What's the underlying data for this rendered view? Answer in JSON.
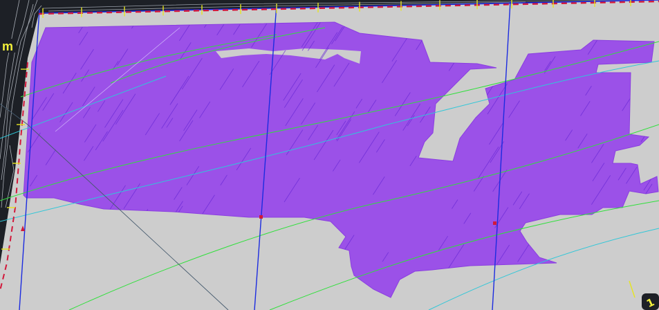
{
  "canvas": {
    "background_dark": "#1d2026",
    "sheet_color": "#cdcdcd",
    "polygon_fill": "#9b51e8",
    "polygon_hatch": "#6a2ad6",
    "grid_blue": "#1b2be0",
    "contour_green": "#2fe03a",
    "contour_cyan": "#2fc7d8",
    "boundary_red": "#d2183a",
    "tick_yellow": "#e7e51d",
    "label_yellow": "#f3f13a"
  },
  "labels": {
    "left_label": "m",
    "corner_label": "1"
  },
  "icons": {
    "corner_marker": "corner-marker-icon"
  }
}
